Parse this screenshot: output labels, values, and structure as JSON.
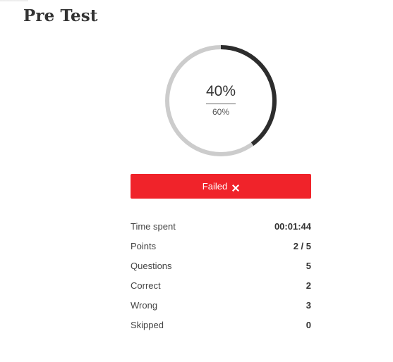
{
  "page": {
    "title": "Pre Test"
  },
  "result": {
    "score_text": "40%",
    "score_fraction": 0.4,
    "passing_text": "60%",
    "status_label": "Failed",
    "status_icon": "close-icon"
  },
  "stats": [
    {
      "label": "Time spent",
      "value": "00:01:44"
    },
    {
      "label": "Points",
      "value": "2 / 5"
    },
    {
      "label": "Questions",
      "value": "5"
    },
    {
      "label": "Correct",
      "value": "2"
    },
    {
      "label": "Wrong",
      "value": "3"
    },
    {
      "label": "Skipped",
      "value": "0"
    }
  ],
  "colors": {
    "progress": "#2d2d2d",
    "track": "#cccccc",
    "failed": "#f0232a"
  }
}
